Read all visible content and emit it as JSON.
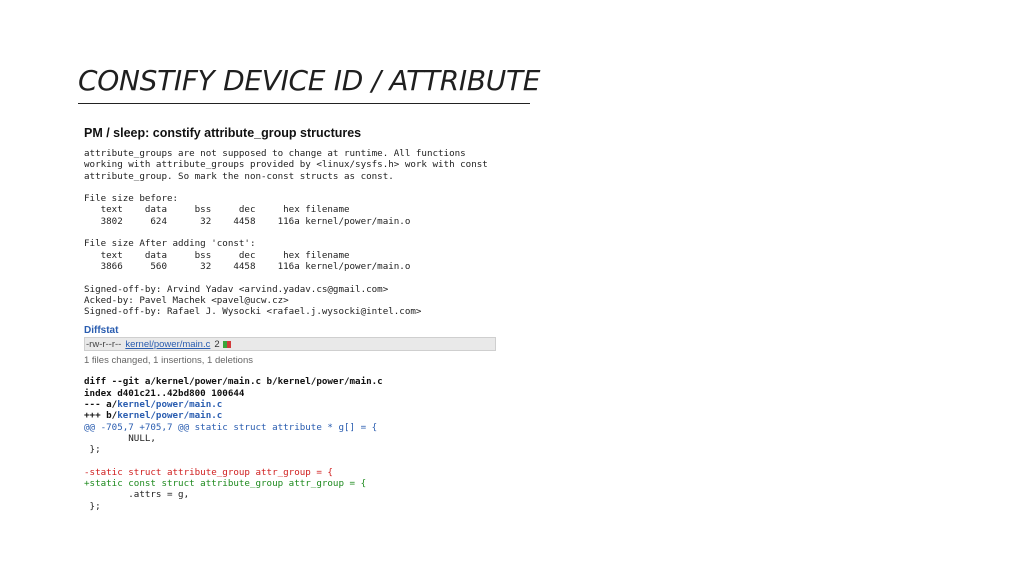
{
  "slide": {
    "title": "CONSTIFY DEVICE ID / ATTRIBUTE"
  },
  "commit": {
    "subject": "PM / sleep: constify attribute_group structures",
    "body": [
      "attribute_groups are not supposed to change at runtime. All functions",
      "working with attribute_groups provided by <linux/sysfs.h> work with const",
      "attribute_group. So mark the non-const structs as const."
    ],
    "size_before_label": "File size before:",
    "size_before_rows": [
      "   text    data     bss     dec     hex filename",
      "   3802     624      32    4458    116a kernel/power/main.o"
    ],
    "size_after_label": "File size After adding 'const':",
    "size_after_rows": [
      "   text    data     bss     dec     hex filename",
      "   3866     560      32    4458    116a kernel/power/main.o"
    ],
    "signoffs": [
      "Signed-off-by: Arvind Yadav <arvind.yadav.cs@gmail.com>",
      "Acked-by: Pavel Machek <pavel@ucw.cz>",
      "Signed-off-by: Rafael J. Wysocki <rafael.j.wysocki@intel.com>"
    ]
  },
  "diffstat": {
    "title": "Diffstat",
    "perm": "-rw-r--r--",
    "file": "kernel/power/main.c",
    "count": "2",
    "summary": "1 files changed, 1 insertions, 1 deletions",
    "colors": {
      "plus": "#3aa53a",
      "minus": "#d23b3b"
    }
  },
  "diff": {
    "header": "diff --git a/kernel/power/main.c b/kernel/power/main.c",
    "index": "index d401c21..42bd800 100644",
    "minus_prefix": "--- a/",
    "minus_file": "kernel/power/main.c",
    "plus_prefix": "+++ b/",
    "plus_file": "kernel/power/main.c",
    "hunk": "@@ -705,7 +705,7 @@ static struct attribute * g[] = {",
    "ctx1": "        NULL,",
    "ctx2": " };",
    "removed": "-static struct attribute_group attr_group = {",
    "added": "+static const struct attribute_group attr_group = {",
    "ctx3": "        .attrs = g,",
    "ctx4": " };"
  }
}
